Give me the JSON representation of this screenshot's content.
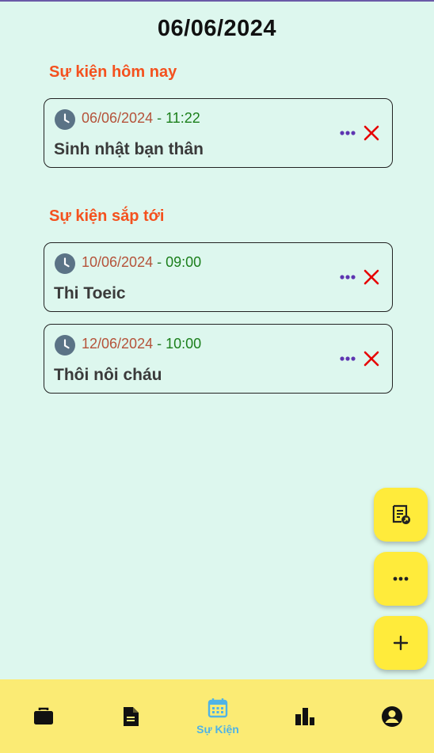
{
  "header": {
    "date": "06/06/2024"
  },
  "sections": {
    "today_title": "Sự kiện hôm nay",
    "upcoming_title": "Sự kiện sắp tới"
  },
  "events_today": [
    {
      "date": "06/06/2024",
      "separator": " - ",
      "time": "11:22",
      "name": "Sinh nhật bạn thân"
    }
  ],
  "events_upcoming": [
    {
      "date": "10/06/2024",
      "separator": " - ",
      "time": "09:00",
      "name": "Thi Toeic"
    },
    {
      "date": "12/06/2024",
      "separator": " - ",
      "time": "10:00",
      "name": "Thôi nôi cháu"
    }
  ],
  "fabs": [
    "report-icon",
    "more-icon",
    "add-icon"
  ],
  "bottom_nav": {
    "items": [
      {
        "icon": "briefcase-icon"
      },
      {
        "icon": "document-icon"
      },
      {
        "icon": "calendar-icon",
        "label": "Sự Kiện",
        "active": true
      },
      {
        "icon": "bar-chart-icon"
      },
      {
        "icon": "account-icon"
      }
    ]
  },
  "colors": {
    "background": "#ddf7ee",
    "section_title": "#f4511e",
    "date": "#b5533a",
    "time": "#1b7f1b",
    "accent_purple": "#5e35b1",
    "delete_red": "#e60000",
    "fab": "#ffeb3b",
    "nav_bg": "#fbeb74",
    "nav_active": "#4fb3e6"
  }
}
